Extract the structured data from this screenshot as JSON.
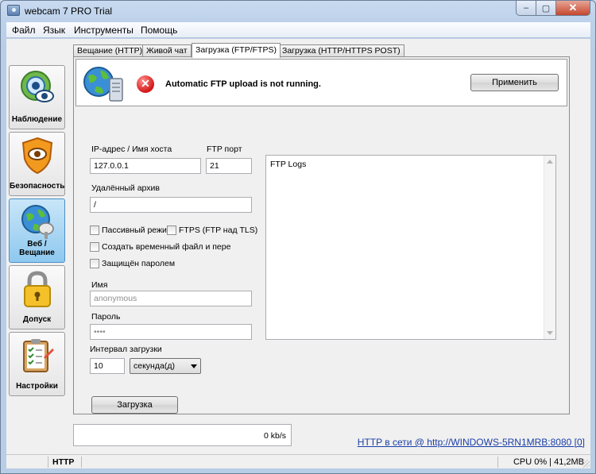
{
  "window": {
    "title": "webcam 7 PRO Trial",
    "minimize": "–",
    "maximize": "▢",
    "close": "✕"
  },
  "menu": [
    "Файл",
    "Язык",
    "Инструменты",
    "Помощь"
  ],
  "sidebar": [
    {
      "label": "Наблюдение",
      "icon": "webcam-eye-icon"
    },
    {
      "label": "Безопасность",
      "icon": "shield-eye-icon"
    },
    {
      "label": "Веб / Вещание",
      "icon": "globe-satellite-icon",
      "active": true
    },
    {
      "label": "Допуск",
      "icon": "padlock-icon"
    },
    {
      "label": "Настройки",
      "icon": "clipboard-settings-icon"
    }
  ],
  "tabs": [
    "Вещание (HTTP)",
    "Живой чат",
    "Загрузка (FTP/FTPS)",
    "Загрузка (HTTP/HTTPS POST)"
  ],
  "active_tab": 2,
  "ftp": {
    "status_text": "Automatic FTP upload is not running.",
    "apply_label": "Применить",
    "host_label": "IP-адрес / Имя хоста",
    "host_value": "127.0.0.1",
    "port_label": "FTP порт",
    "port_value": "21",
    "remote_label": "Удалённый архив",
    "remote_value": "/",
    "passive_label": "Пассивный режи",
    "ftps_label": "FTPS (FTP над TLS)",
    "temp_label": "Создать временный файл и пере",
    "password_protect_label": "Защищён паролем",
    "user_label": "Имя",
    "user_value": "anonymous",
    "pass_label": "Пароль",
    "pass_value": "••••",
    "interval_label": "Интервал загрузки",
    "interval_value": "10",
    "interval_unit": "секунда(д)",
    "upload_label": "Загрузка",
    "log_title": "FTP Logs"
  },
  "speed": "0 kb/s",
  "http_link": "HTTP в сети @ http://WINDOWS-5RN1MRB:8080 [0]",
  "statusbar": {
    "mode": "HTTP",
    "cpu": "CPU 0% | 41,2MB"
  }
}
